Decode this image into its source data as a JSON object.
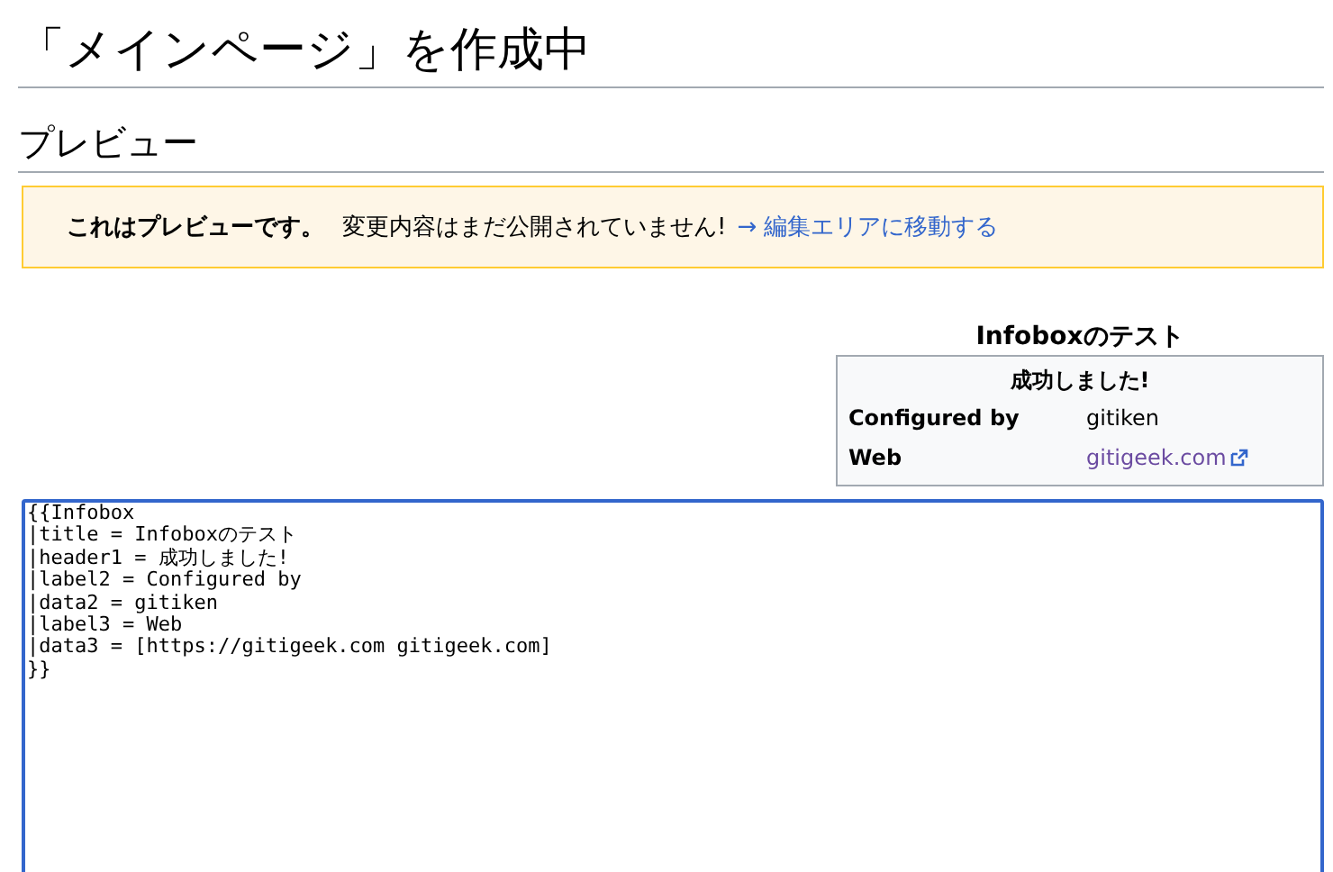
{
  "page_title": "「メインページ」を作成中",
  "section_heading": "プレビュー",
  "notice": {
    "bold": "これはプレビューです。",
    "text": "変更内容はまだ公開されていません!",
    "link": "→ 編集エリアに移動する"
  },
  "infobox": {
    "title": "Infoboxのテスト",
    "header": "成功しました!",
    "rows": [
      {
        "label": "Configured by",
        "value": "gitiken",
        "external": false
      },
      {
        "label": "Web",
        "value": "gitigeek.com",
        "external": true
      }
    ]
  },
  "editor": {
    "lines": [
      "{{Infobox",
      "|title = Infoboxのテスト",
      "|header1 = 成功しました!",
      "|label2 = Configured by",
      "|data2 = gitiken",
      "|label3 = Web",
      "|data3 = [https://gitigeek.com gitigeek.com]",
      "}}"
    ]
  }
}
